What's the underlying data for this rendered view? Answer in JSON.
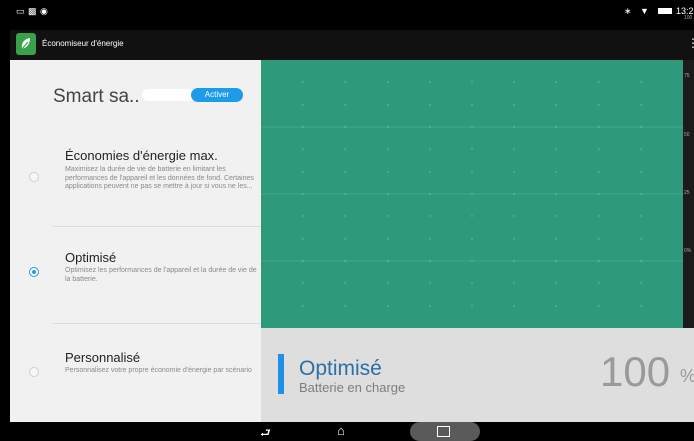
{
  "status_bar": {
    "time": "13:2",
    "icons": [
      "screen-icon",
      "notification-icon",
      "android-icon",
      "bluetooth-icon",
      "wifi-icon",
      "battery-icon"
    ]
  },
  "app_bar": {
    "title": "Économiseur d'énergie",
    "icon": "leaf-icon",
    "brand_color": "#3aa14a"
  },
  "smart": {
    "title": "Smart sa..",
    "button_label": "Activer"
  },
  "options": [
    {
      "title": "Économies d'énergie max.",
      "description": "Maximisez la durée de vie de batterie en limitant les performances de l'appareil et les données de fond. Certaines applications peuvent ne pas se mettre à jour si vous ne les...",
      "selected": false
    },
    {
      "title": "Optimisé",
      "description": "Optimisez les performances de l'appareil et la durée de vie de la batterie.",
      "selected": true
    },
    {
      "title": "Personnalisé",
      "description": "Personnalisez votre propre économie d'énergie par scénario",
      "selected": false
    }
  ],
  "chart_data": {
    "type": "line",
    "y_ticks": [
      "100",
      "75",
      "50",
      "25",
      "0%"
    ],
    "ylim": [
      0,
      100
    ],
    "grid": true,
    "fill_color": "#2e9a7b"
  },
  "status": {
    "mode": "Optimisé",
    "charging": "Batterie en charge",
    "percent": "100",
    "percent_sign": "%"
  },
  "accent_color": "#1e9be8"
}
